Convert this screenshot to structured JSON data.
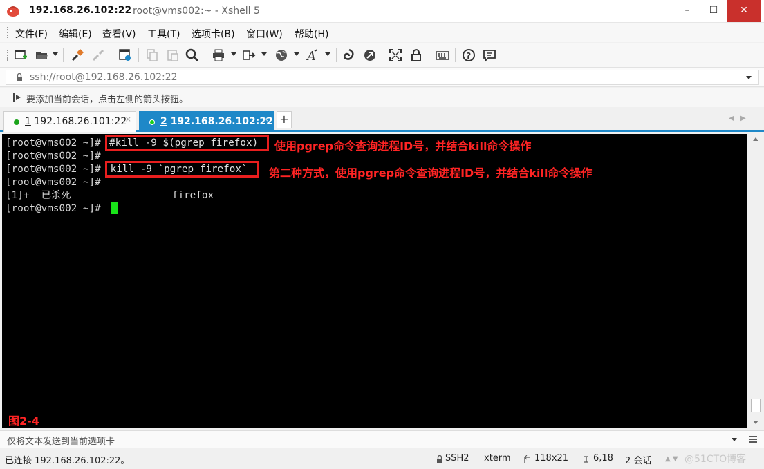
{
  "window": {
    "title_host": "192.168.26.102:22",
    "title_app": "root@vms002:~ - Xshell 5",
    "minimize": "–",
    "maximize": "☐",
    "close": "✕"
  },
  "menu": [
    "文件(F)",
    "编辑(E)",
    "查看(V)",
    "工具(T)",
    "选项卡(B)",
    "窗口(W)",
    "帮助(H)"
  ],
  "address": {
    "value": "ssh://root@192.168.26.102:22"
  },
  "hint": {
    "text": "要添加当前会话，点击左侧的箭头按钮。"
  },
  "tabs": [
    {
      "num": "1",
      "host": "192.168.26.101:22",
      "active": false
    },
    {
      "num": "2",
      "host": "192.168.26.102:22",
      "active": true
    }
  ],
  "tab_add": "+",
  "tab_nav": {
    "prev": "◀",
    "next": "▶"
  },
  "terminal": {
    "prompt": "[root@vms002 ~]#",
    "lines": [
      {
        "prompt": "[root@vms002 ~]#",
        "cmd": "#kill -9 $(pgrep firefox)"
      },
      {
        "prompt": "[root@vms002 ~]#",
        "cmd": ""
      },
      {
        "prompt": "[root@vms002 ~]#",
        "cmd": " kill -9 `pgrep firefox`"
      },
      {
        "prompt": "[root@vms002 ~]#",
        "cmd": ""
      }
    ],
    "job_line": "[1]+  已杀死                 firefox",
    "last_prompt": "[root@vms002 ~]#",
    "annotations": [
      "使用pgrep命令查询进程ID号，并结合kill命令操作",
      "第二种方式，使用pgrep命令查询进程ID号，并结合kill命令操作"
    ],
    "figure_label": "图2-4"
  },
  "sendbar": {
    "placeholder": "仅将文本发送到当前选项卡"
  },
  "status": {
    "connection": "已连接 192.168.26.102:22。",
    "protocol": "SSH2",
    "term_type": "xterm",
    "size": "118x21",
    "cursor_pos": "6,18",
    "sessions": "2 会话",
    "watermark": "@51CTO博客"
  },
  "colors": {
    "accent": "#1e88c8",
    "annotation": "#ff2424",
    "cursor": "#19e419",
    "close_button": "#c9302c"
  },
  "icons": [
    "new-session-icon",
    "open-folder-icon",
    "connect-icon",
    "disconnect-icon",
    "properties-icon",
    "copy-icon",
    "paste-icon",
    "find-icon",
    "print-icon",
    "transfer-icon",
    "globe-icon",
    "font-icon",
    "xftp-icon",
    "xmanager-icon",
    "fullscreen-icon",
    "lock-icon",
    "keyboard-icon",
    "help-icon",
    "chat-icon"
  ]
}
